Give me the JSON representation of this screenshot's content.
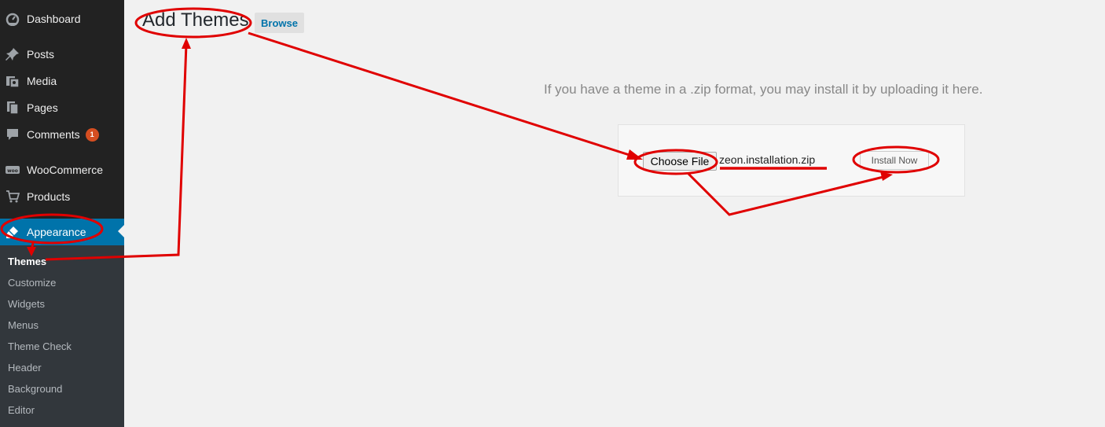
{
  "sidebar": {
    "items": [
      {
        "label": "Dashboard",
        "icon": "dashboard-icon"
      },
      {
        "label": "Posts",
        "icon": "pin-icon"
      },
      {
        "label": "Media",
        "icon": "media-icon"
      },
      {
        "label": "Pages",
        "icon": "pages-icon"
      },
      {
        "label": "Comments",
        "icon": "comment-icon",
        "badge": "1"
      },
      {
        "label": "WooCommerce",
        "icon": "woocommerce-icon"
      },
      {
        "label": "Products",
        "icon": "cart-icon"
      },
      {
        "label": "Appearance",
        "icon": "brush-icon",
        "active": true
      }
    ],
    "submenu": [
      {
        "label": "Themes",
        "current": true
      },
      {
        "label": "Customize"
      },
      {
        "label": "Widgets"
      },
      {
        "label": "Menus"
      },
      {
        "label": "Theme Check"
      },
      {
        "label": "Header"
      },
      {
        "label": "Background"
      },
      {
        "label": "Editor"
      }
    ]
  },
  "header": {
    "title": "Add Themes",
    "browse_label": "Browse"
  },
  "upload": {
    "help_text": "If you have a theme in a .zip format, you may install it by uploading it here.",
    "choose_file_label": "Choose File",
    "file_name": "zeon.installation.zip",
    "install_label": "Install Now"
  },
  "colors": {
    "sidebar_bg": "#222222",
    "active_bg": "#0073aa",
    "submenu_bg": "#32373c",
    "annotation": "#e00000",
    "badge": "#d54e21"
  }
}
